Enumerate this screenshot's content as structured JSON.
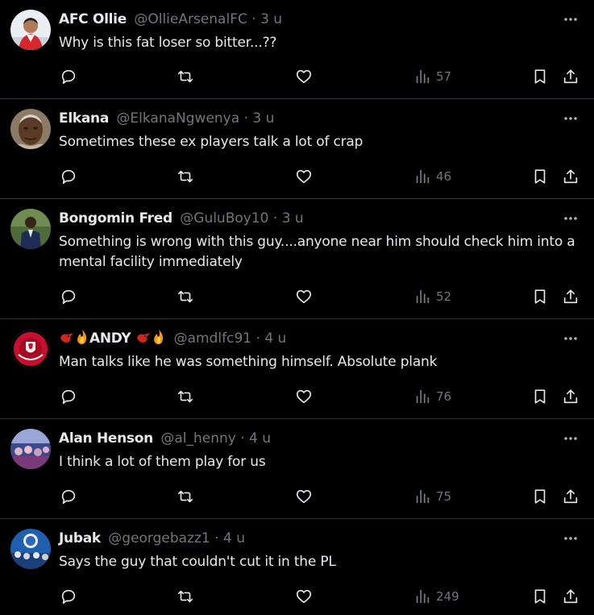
{
  "colors": {
    "background": "#000000",
    "text": "#e7e9ea",
    "muted": "#71767b",
    "divider": "#2f3336"
  },
  "tweets": [
    {
      "display_name": "AFC Ollie",
      "handle": "@OllieArsenalFC",
      "dot": "·",
      "time": "3 u",
      "text": "Why is this fat loser so bitter...??",
      "views": "57",
      "avatar_icon": "arsenal-player-avatar"
    },
    {
      "display_name": "Elkana",
      "handle": "@ElkanaNgwenya",
      "dot": "·",
      "time": "3 u",
      "text": "Sometimes these ex players talk a lot of crap",
      "views": "46",
      "avatar_icon": "man-portrait-avatar"
    },
    {
      "display_name": "Bongomin Fred",
      "handle": "@GuluBoy10",
      "dot": "·",
      "time": "3 u",
      "text": "Something is wrong with this guy....anyone near him should check him into a mental facility immediately",
      "views": "52",
      "avatar_icon": "man-in-suit-avatar"
    },
    {
      "display_name": "ANDY",
      "handle": "@amdlfc91",
      "dot": "·",
      "time": "4 u",
      "text": "Man talks like he was something himself. Absolute plank",
      "views": "76",
      "avatar_icon": "liverpool-crest-avatar"
    },
    {
      "display_name": "Alan Henson",
      "handle": "@al_henny",
      "dot": "·",
      "time": "4 u",
      "text": "I think a lot of them play for us",
      "views": "75",
      "avatar_icon": "crowd-avatar"
    },
    {
      "display_name": "Jubak",
      "handle": "@georgebazz1",
      "dot": "·",
      "time": "4 u",
      "text": "Says the guy that couldn't cut it in the PL",
      "views": "249",
      "avatar_icon": "chelsea-fans-avatar"
    }
  ]
}
